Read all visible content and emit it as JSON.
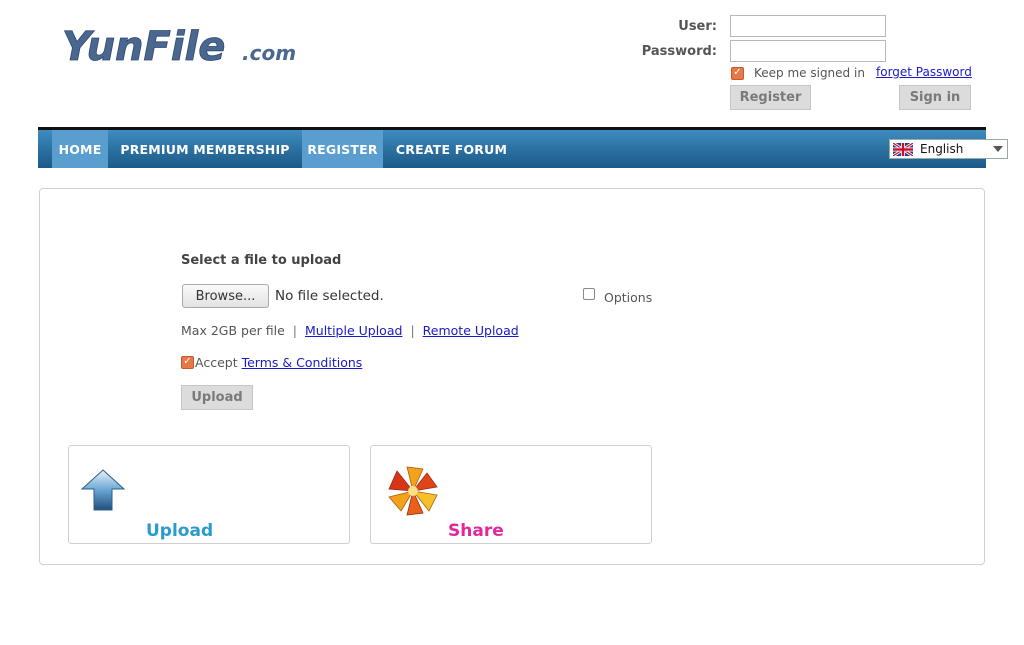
{
  "site": {
    "logo_text": "YunFile",
    "logo_suffix": ".com"
  },
  "login": {
    "user_label": "User:",
    "password_label": "Password:",
    "user_value": "",
    "password_value": "",
    "keep_signed_label": "Keep me signed in",
    "keep_signed_checked": true,
    "forget_password_link": "forget Password",
    "register_button": "Register",
    "sign_in_button": "Sign in"
  },
  "nav": {
    "items": [
      {
        "label": "HOME",
        "active": true
      },
      {
        "label": "PREMIUM MEMBERSHIP",
        "active": false
      },
      {
        "label": "REGISTER",
        "active": true
      },
      {
        "label": "CREATE FORUM",
        "active": false
      }
    ],
    "language": {
      "selected": "English",
      "flag_icon": "uk-flag-icon"
    }
  },
  "upload": {
    "heading": "Select a file to upload",
    "browse_button": "Browse...",
    "file_status": "No file selected.",
    "options_label": "Options",
    "options_checked": false,
    "max_size_text": "Max 2GB per file",
    "separator": "|",
    "multiple_upload_link": "Multiple Upload",
    "remote_upload_link": "Remote Upload",
    "accept_label": "Accept",
    "accept_checked": true,
    "terms_link": "Terms & Conditions",
    "upload_button": "Upload"
  },
  "features": [
    {
      "title": "Upload",
      "icon": "upload-arrow-icon",
      "color": "#2a9bd0"
    },
    {
      "title": "Share",
      "icon": "share-pinwheel-icon",
      "color": "#e0289a"
    }
  ],
  "colors": {
    "nav_bar": "#2a6fa0",
    "nav_active": "#5a9ed0",
    "link": "#1a1ac8",
    "check_orange": "#e8784a",
    "logo_blue": "#4a6790"
  }
}
